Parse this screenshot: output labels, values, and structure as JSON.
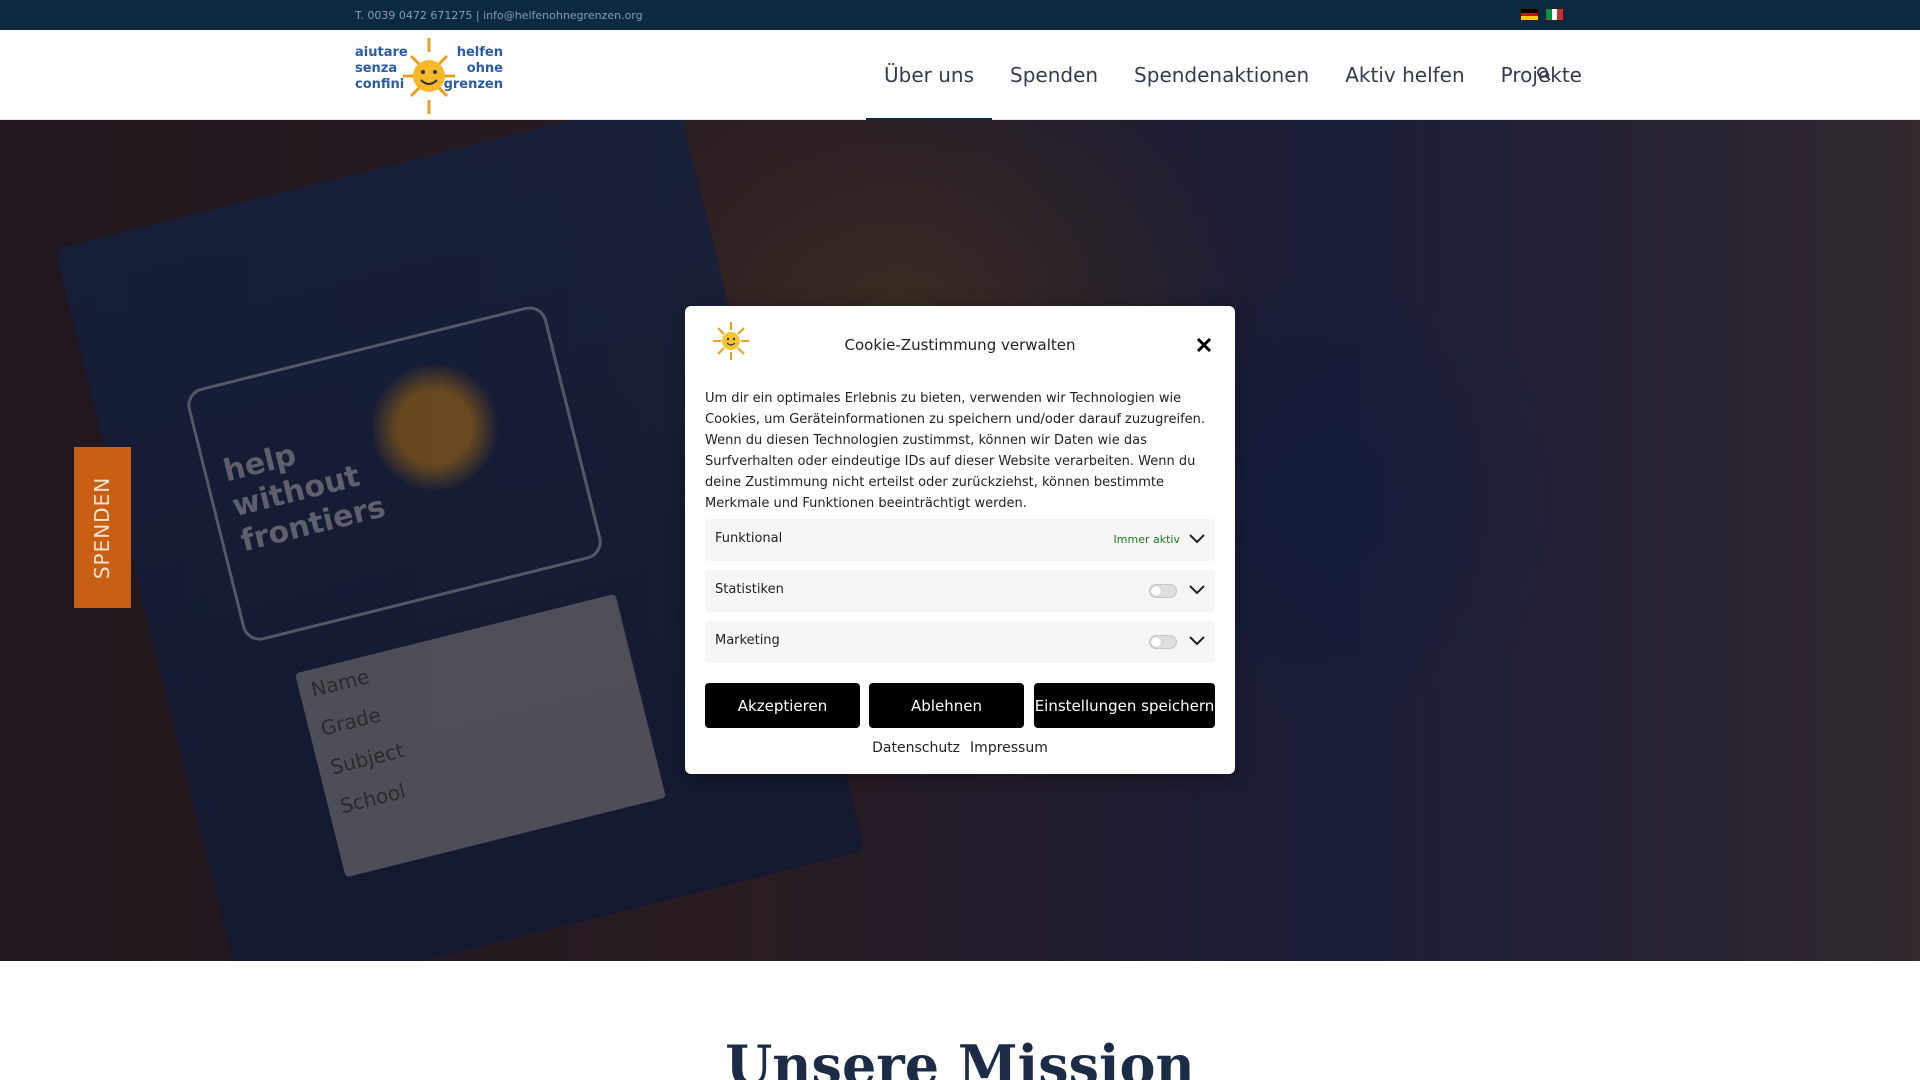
{
  "topbar": {
    "contact": "T. 0039 0472 671275 | info@helfenohnegrenzen.org",
    "flags": [
      "de-flag-icon",
      "it-flag-icon"
    ]
  },
  "header": {
    "logo_text": {
      "left": [
        "aiutare",
        "senza",
        "confini"
      ],
      "right": [
        "helfen",
        "ohne",
        "grenzen"
      ]
    },
    "nav": [
      {
        "label": "Über uns",
        "active": true
      },
      {
        "label": "Spenden",
        "active": false
      },
      {
        "label": "Spendenaktionen",
        "active": false
      },
      {
        "label": "Aktiv helfen",
        "active": false
      },
      {
        "label": "Projekte",
        "active": false
      }
    ],
    "search_icon": "search-icon"
  },
  "hero": {
    "spenden_tab": "SPENDEN",
    "book_text": [
      "help",
      "without",
      "frontiers"
    ],
    "book_fields": [
      "Name",
      "Grade",
      "Subject",
      "School"
    ]
  },
  "mission": {
    "title": "Unsere Mission"
  },
  "cookie_modal": {
    "title": "Cookie-Zustimmung verwalten",
    "description": "Um dir ein optimales Erlebnis zu bieten, verwenden wir Technologien wie Cookies, um Geräteinformationen zu speichern und/oder darauf zuzugreifen. Wenn du diesen Technologien zustimmst, können wir Daten wie das Surfverhalten oder eindeutige IDs auf dieser Website verarbeiten. Wenn du deine Zustimmung nicht erteilst oder zurückziehst, können bestimmte Merkmale und Funktionen beeinträchtigt werden.",
    "categories": [
      {
        "label": "Funktional",
        "status": "Immer aktiv"
      },
      {
        "label": "Statistiken",
        "status": ""
      },
      {
        "label": "Marketing",
        "status": ""
      }
    ],
    "buttons": {
      "accept": "Akzeptieren",
      "deny": "Ablehnen",
      "save": "Einstellungen speichern"
    },
    "links": {
      "privacy": "Datenschutz",
      "imprint": "Impressum"
    }
  },
  "colors": {
    "topbar_bg": "#0b2940",
    "accent_orange": "#c85f14",
    "button_bg": "#000000",
    "always_active": "#1c7a1c"
  }
}
